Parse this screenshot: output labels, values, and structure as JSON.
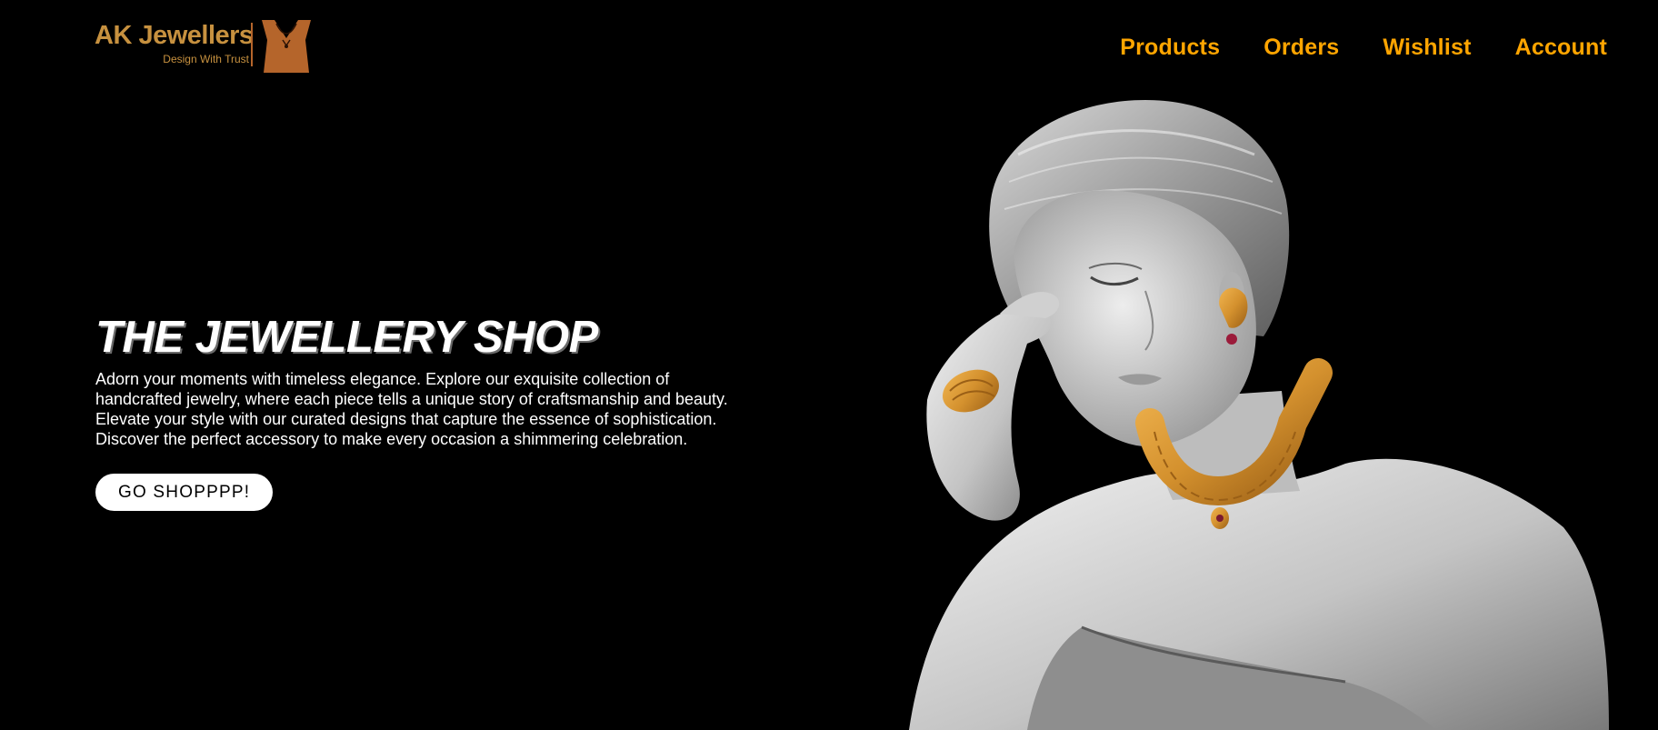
{
  "brand": {
    "name": "AK Jewellers",
    "tagline": "Design With Trust",
    "color": "#c7913f",
    "mark_color": "#b5652b",
    "logo_icon": "necklace-bust-icon"
  },
  "nav": {
    "color": "#ffa500",
    "items": [
      {
        "label": "Products"
      },
      {
        "label": "Orders"
      },
      {
        "label": "Wishlist"
      },
      {
        "label": "Account"
      }
    ]
  },
  "hero": {
    "title": "THE JEWELLERY SHOP",
    "description": "Adorn your moments with timeless elegance. Explore our exquisite collection of handcrafted jewelry, where each piece tells a unique story of craftsmanship and beauty. Elevate your style with our curated designs that capture the essence of sophistication. Discover the perfect accessory to make every occasion a shimmering celebration.",
    "cta_label": "GO SHOPPPP!"
  },
  "hero_image": {
    "subject": "woman-wearing-gold-jewellery-image",
    "jewel_color": "#d4912e"
  }
}
